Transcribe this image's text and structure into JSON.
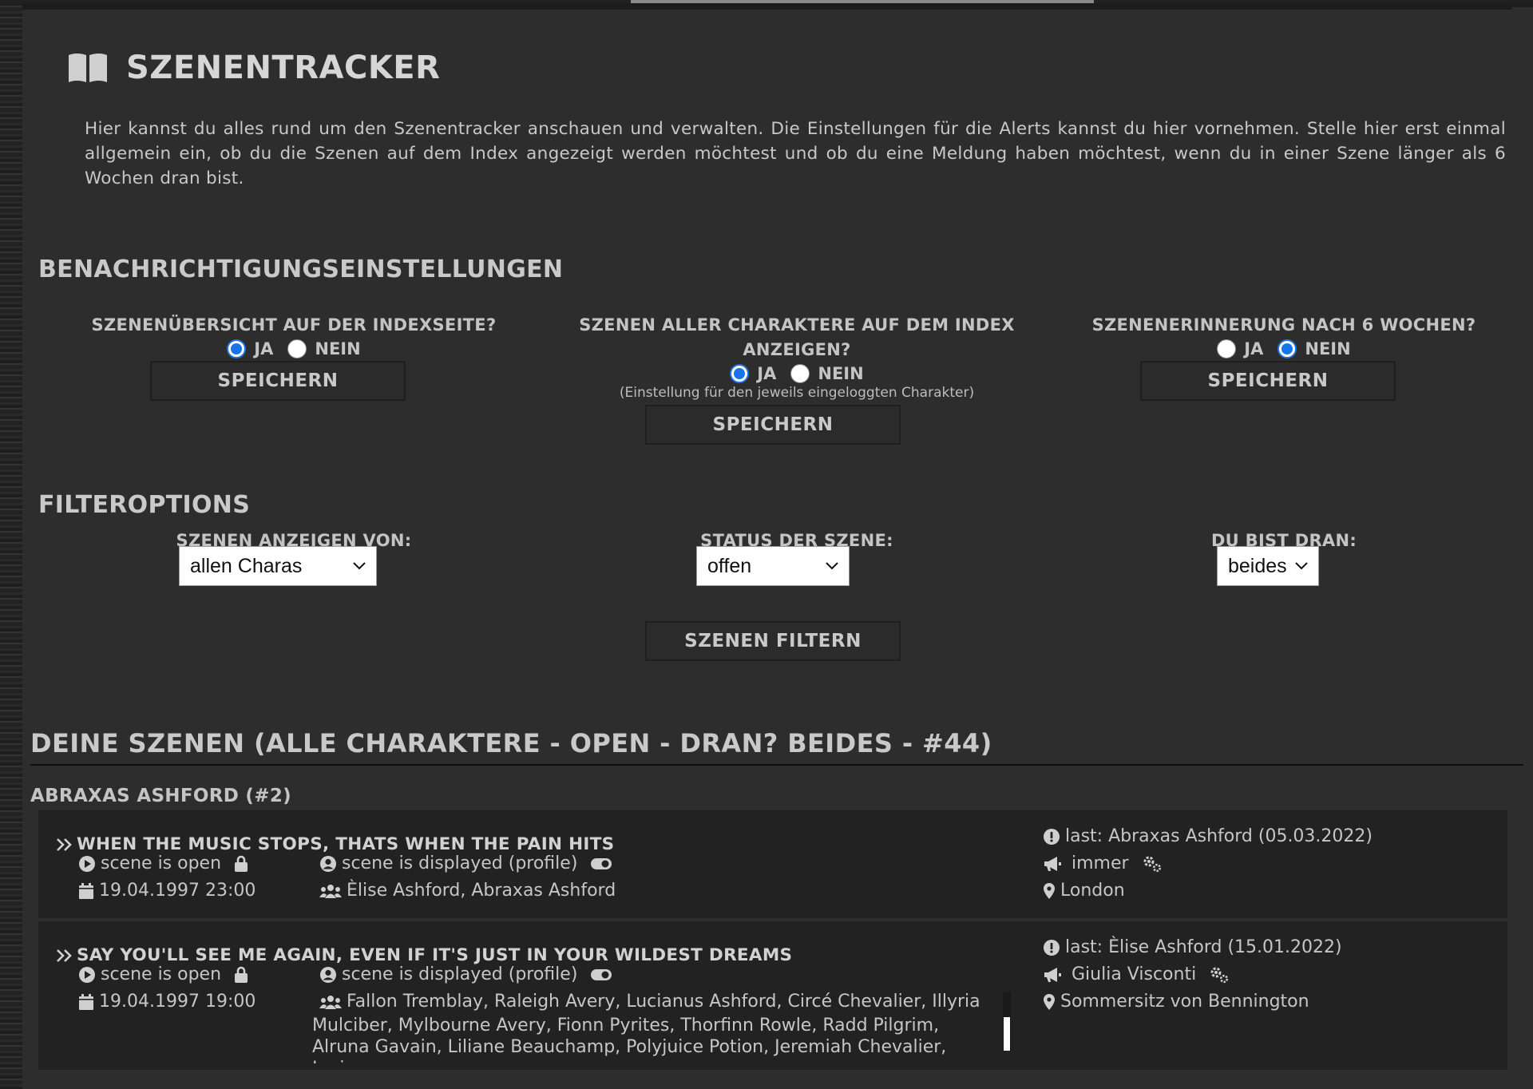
{
  "page_title": "SZENENTRACKER",
  "intro": "Hier kannst du alles rund um den Szenentracker anschauen und verwalten. Die Einstellungen für die Alerts kannst du hier vornehmen. Stelle hier erst einmal allgemein ein, ob du die Szenen auf dem Index angezeigt werden möchtest und ob du eine Meldung haben möchtest, wenn du in einer Szene länger als 6 Wochen dran bist.",
  "notifications": {
    "heading": "BENACHRICHTIGUNGSEINSTELLUNGEN",
    "ja_label": "JA",
    "nein_label": "NEIN",
    "save_label": "SPEICHERN",
    "col1": {
      "title": "SZENENÜBERSICHT AUF DER INDEXSEITE?",
      "selected": "ja"
    },
    "col2": {
      "title_line1": "SZENEN ALLER CHARAKTERE AUF DEM INDEX",
      "title_line2": "ANZEIGEN?",
      "selected": "ja",
      "hint": "(Einstellung für den jeweils eingeloggten Charakter)"
    },
    "col3": {
      "title": "SZENENERINNERUNG NACH 6 WOCHEN?",
      "selected": "nein"
    }
  },
  "filters": {
    "heading": "FILTEROPTIONS",
    "show_from_label": "SZENEN ANZEIGEN VON:",
    "show_from_value": "allen Charas",
    "status_label": "STATUS DER SZENE:",
    "status_value": "offen",
    "turn_label": "DU BIST DRAN:",
    "turn_value": "beides",
    "filter_button": "SZENEN FILTERN"
  },
  "scenes_section": {
    "heading": "DEINE SZENEN (ALLE CHARAKTERE - OPEN - DRAN? BEIDES - #44)",
    "character_heading": "ABRAXAS ASHFORD (#2)",
    "scenes": [
      {
        "title": "WHEN THE MUSIC STOPS, THATS WHEN THE PAIN HITS",
        "status": "scene is open",
        "display": "scene is displayed (profile)",
        "date": "19.04.1997 23:00",
        "participants": "Èlise Ashford, Abraxas Ashford",
        "last": "last: Abraxas Ashford (05.03.2022)",
        "alert": "immer",
        "location": "London"
      },
      {
        "title": "SAY YOU'LL SEE ME AGAIN, EVEN IF IT'S JUST IN YOUR WILDEST DREAMS",
        "status": "scene is open",
        "display": "scene is displayed (profile)",
        "date": "19.04.1997 19:00",
        "participants_line1": "Fallon Tremblay, Raleigh Avery, Lucianus Ashford, Circé Chevalier, Illyria",
        "participants_rest": "Mulciber, Mylbourne Avery, Fionn Pyrites, Thorfinn Rowle, Radd Pilgrim, Alruna Gavain, Liliane Beauchamp, Polyjuice Potion, Jeremiah Chevalier, Juniper",
        "last": "last: Èlise Ashford (15.01.2022)",
        "alert": "Giulia Visconti",
        "location": "Sommersitz von Bennington"
      }
    ]
  }
}
